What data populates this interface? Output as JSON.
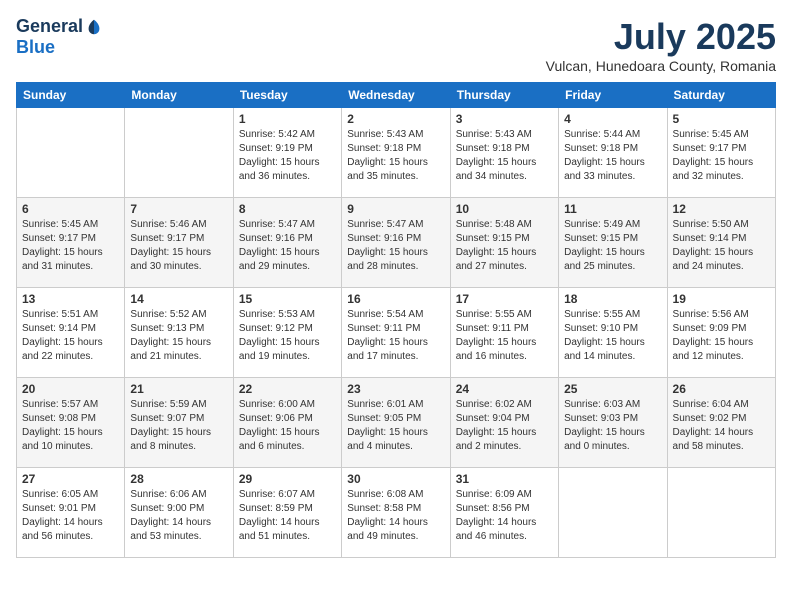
{
  "header": {
    "logo_general": "General",
    "logo_blue": "Blue",
    "month_title": "July 2025",
    "location": "Vulcan, Hunedoara County, Romania"
  },
  "weekdays": [
    "Sunday",
    "Monday",
    "Tuesday",
    "Wednesday",
    "Thursday",
    "Friday",
    "Saturday"
  ],
  "weeks": [
    [
      {
        "day": "",
        "info": ""
      },
      {
        "day": "",
        "info": ""
      },
      {
        "day": "1",
        "info": "Sunrise: 5:42 AM\nSunset: 9:19 PM\nDaylight: 15 hours\nand 36 minutes."
      },
      {
        "day": "2",
        "info": "Sunrise: 5:43 AM\nSunset: 9:18 PM\nDaylight: 15 hours\nand 35 minutes."
      },
      {
        "day": "3",
        "info": "Sunrise: 5:43 AM\nSunset: 9:18 PM\nDaylight: 15 hours\nand 34 minutes."
      },
      {
        "day": "4",
        "info": "Sunrise: 5:44 AM\nSunset: 9:18 PM\nDaylight: 15 hours\nand 33 minutes."
      },
      {
        "day": "5",
        "info": "Sunrise: 5:45 AM\nSunset: 9:17 PM\nDaylight: 15 hours\nand 32 minutes."
      }
    ],
    [
      {
        "day": "6",
        "info": "Sunrise: 5:45 AM\nSunset: 9:17 PM\nDaylight: 15 hours\nand 31 minutes."
      },
      {
        "day": "7",
        "info": "Sunrise: 5:46 AM\nSunset: 9:17 PM\nDaylight: 15 hours\nand 30 minutes."
      },
      {
        "day": "8",
        "info": "Sunrise: 5:47 AM\nSunset: 9:16 PM\nDaylight: 15 hours\nand 29 minutes."
      },
      {
        "day": "9",
        "info": "Sunrise: 5:47 AM\nSunset: 9:16 PM\nDaylight: 15 hours\nand 28 minutes."
      },
      {
        "day": "10",
        "info": "Sunrise: 5:48 AM\nSunset: 9:15 PM\nDaylight: 15 hours\nand 27 minutes."
      },
      {
        "day": "11",
        "info": "Sunrise: 5:49 AM\nSunset: 9:15 PM\nDaylight: 15 hours\nand 25 minutes."
      },
      {
        "day": "12",
        "info": "Sunrise: 5:50 AM\nSunset: 9:14 PM\nDaylight: 15 hours\nand 24 minutes."
      }
    ],
    [
      {
        "day": "13",
        "info": "Sunrise: 5:51 AM\nSunset: 9:14 PM\nDaylight: 15 hours\nand 22 minutes."
      },
      {
        "day": "14",
        "info": "Sunrise: 5:52 AM\nSunset: 9:13 PM\nDaylight: 15 hours\nand 21 minutes."
      },
      {
        "day": "15",
        "info": "Sunrise: 5:53 AM\nSunset: 9:12 PM\nDaylight: 15 hours\nand 19 minutes."
      },
      {
        "day": "16",
        "info": "Sunrise: 5:54 AM\nSunset: 9:11 PM\nDaylight: 15 hours\nand 17 minutes."
      },
      {
        "day": "17",
        "info": "Sunrise: 5:55 AM\nSunset: 9:11 PM\nDaylight: 15 hours\nand 16 minutes."
      },
      {
        "day": "18",
        "info": "Sunrise: 5:55 AM\nSunset: 9:10 PM\nDaylight: 15 hours\nand 14 minutes."
      },
      {
        "day": "19",
        "info": "Sunrise: 5:56 AM\nSunset: 9:09 PM\nDaylight: 15 hours\nand 12 minutes."
      }
    ],
    [
      {
        "day": "20",
        "info": "Sunrise: 5:57 AM\nSunset: 9:08 PM\nDaylight: 15 hours\nand 10 minutes."
      },
      {
        "day": "21",
        "info": "Sunrise: 5:59 AM\nSunset: 9:07 PM\nDaylight: 15 hours\nand 8 minutes."
      },
      {
        "day": "22",
        "info": "Sunrise: 6:00 AM\nSunset: 9:06 PM\nDaylight: 15 hours\nand 6 minutes."
      },
      {
        "day": "23",
        "info": "Sunrise: 6:01 AM\nSunset: 9:05 PM\nDaylight: 15 hours\nand 4 minutes."
      },
      {
        "day": "24",
        "info": "Sunrise: 6:02 AM\nSunset: 9:04 PM\nDaylight: 15 hours\nand 2 minutes."
      },
      {
        "day": "25",
        "info": "Sunrise: 6:03 AM\nSunset: 9:03 PM\nDaylight: 15 hours\nand 0 minutes."
      },
      {
        "day": "26",
        "info": "Sunrise: 6:04 AM\nSunset: 9:02 PM\nDaylight: 14 hours\nand 58 minutes."
      }
    ],
    [
      {
        "day": "27",
        "info": "Sunrise: 6:05 AM\nSunset: 9:01 PM\nDaylight: 14 hours\nand 56 minutes."
      },
      {
        "day": "28",
        "info": "Sunrise: 6:06 AM\nSunset: 9:00 PM\nDaylight: 14 hours\nand 53 minutes."
      },
      {
        "day": "29",
        "info": "Sunrise: 6:07 AM\nSunset: 8:59 PM\nDaylight: 14 hours\nand 51 minutes."
      },
      {
        "day": "30",
        "info": "Sunrise: 6:08 AM\nSunset: 8:58 PM\nDaylight: 14 hours\nand 49 minutes."
      },
      {
        "day": "31",
        "info": "Sunrise: 6:09 AM\nSunset: 8:56 PM\nDaylight: 14 hours\nand 46 minutes."
      },
      {
        "day": "",
        "info": ""
      },
      {
        "day": "",
        "info": ""
      }
    ]
  ]
}
